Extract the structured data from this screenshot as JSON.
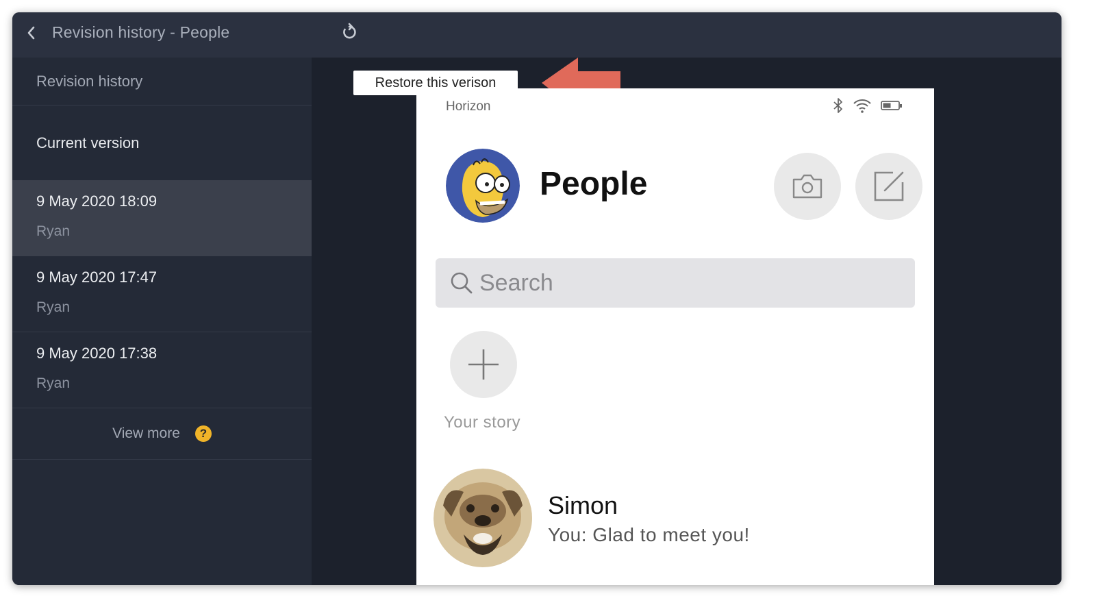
{
  "window": {
    "title": "Revision history - People"
  },
  "sidebar": {
    "header": "Revision history",
    "current_version_label": "Current version",
    "revisions": [
      {
        "date": "9 May 2020 18:09",
        "user": "Ryan",
        "selected": true
      },
      {
        "date": "9 May 2020 17:47",
        "user": "Ryan",
        "selected": false
      },
      {
        "date": "9 May 2020 17:38",
        "user": "Ryan",
        "selected": false
      }
    ],
    "view_more_label": "View more",
    "help_glyph": "?"
  },
  "canvas": {
    "tooltip": "Restore this verison"
  },
  "phone": {
    "carrier": "Horizon",
    "page_title": "People",
    "search_placeholder": "Search",
    "story_label": "Your story",
    "chats": [
      {
        "name": "Simon",
        "message": "You: Glad to meet you!"
      }
    ]
  },
  "colors": {
    "accent_arrow": "#e06a5a",
    "help_badge": "#f0b429",
    "window_bg": "#242a37",
    "selected_row": "#3b404c"
  },
  "icons": [
    "back-chevron-icon",
    "restore-icon",
    "help-icon",
    "bluetooth-icon",
    "wifi-icon",
    "battery-icon",
    "camera-icon",
    "compose-icon",
    "search-icon",
    "plus-icon",
    "red-arrow-icon"
  ]
}
